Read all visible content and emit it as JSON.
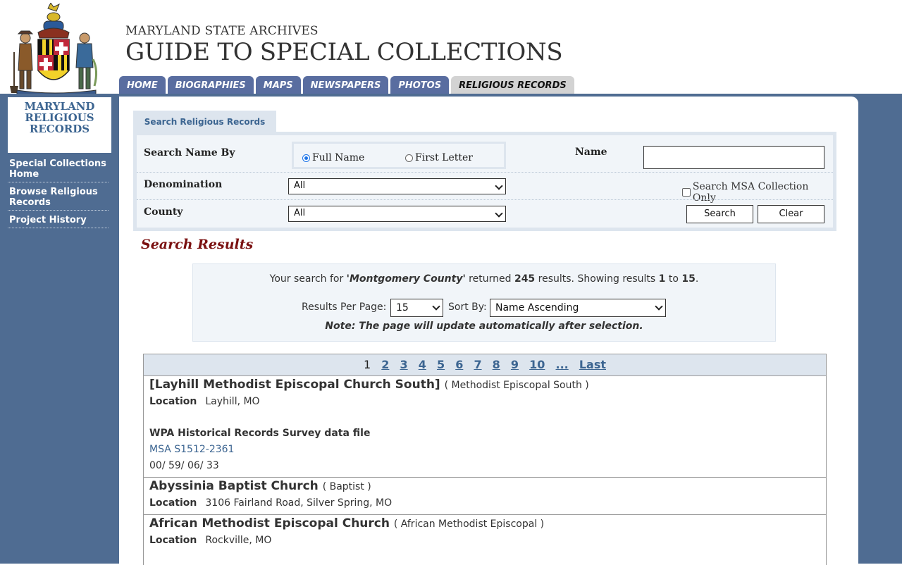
{
  "header": {
    "subtitle": "MARYLAND STATE ARCHIVES",
    "title": "GUIDE TO SPECIAL COLLECTIONS"
  },
  "tabs": [
    "HOME",
    "BIOGRAPHIES",
    "MAPS",
    "NEWSPAPERS",
    "PHOTOS",
    "RELIGIOUS RECORDS"
  ],
  "active_tab": "RELIGIOUS RECORDS",
  "sidebar": {
    "title_lines": [
      "MARYLAND",
      "RELIGIOUS",
      "RECORDS"
    ],
    "links": [
      "Special Collections Home",
      "Browse Religious Records",
      "Project History"
    ]
  },
  "search": {
    "tab_label": "Search Religious Records",
    "name_by_label": "Search Name By",
    "radio_full": "Full Name",
    "radio_first": "First Letter",
    "name_label": "Name",
    "name_value": "",
    "denomination_label": "Denomination",
    "denomination_value": "All",
    "county_label": "County",
    "county_value": "All",
    "msa_only_label": "Search MSA Collection Only",
    "search_button": "Search",
    "clear_button": "Clear"
  },
  "results": {
    "heading": "Search Results",
    "summary_prefix": "Your search for ",
    "query": "'Montgomery County'",
    "summary_mid": " returned ",
    "total": "245",
    "summary_mid2": " results. Showing results ",
    "from": "1",
    "to_word": " to ",
    "to": "15",
    "period": ".",
    "per_page_label": "Results Per Page:",
    "per_page_value": "15",
    "sort_label": "Sort By:",
    "sort_value": "Name Ascending",
    "note": "Note: The page will update automatically after selection.",
    "pager": [
      "1",
      "2",
      "3",
      "4",
      "5",
      "6",
      "7",
      "8",
      "9",
      "10",
      "...",
      "Last"
    ],
    "current_page": "1",
    "records": [
      {
        "name": "[Layhill Methodist Episcopal Church South]",
        "denomination": "( Methodist Episcopal South )",
        "location_label": "Location",
        "location": "Layhill, MO",
        "source": "WPA Historical Records Survey data file",
        "msa": "MSA S1512-2361",
        "code": "00/ 59/ 06/ 33"
      },
      {
        "name": "Abyssinia Baptist Church",
        "denomination": "( Baptist )",
        "location_label": "Location",
        "location": "3106 Fairland Road, Silver Spring, MO"
      },
      {
        "name": "African Methodist Episcopal Church",
        "denomination": "( African Methodist Episcopal )",
        "location_label": "Location",
        "location": "Rockville, MO"
      }
    ]
  }
}
